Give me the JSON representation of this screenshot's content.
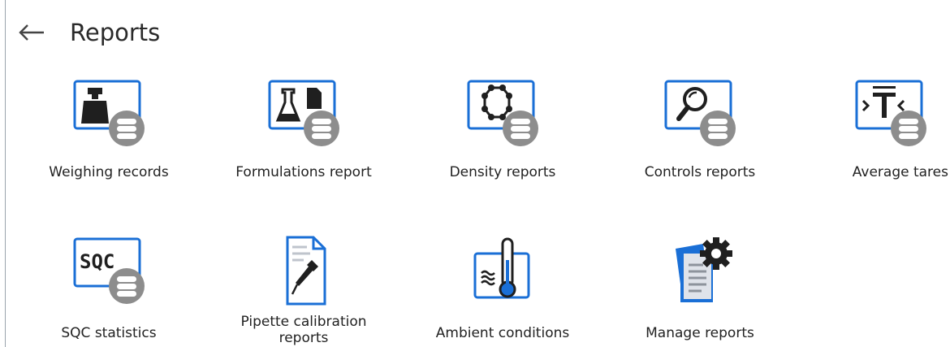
{
  "header": {
    "title": "Reports",
    "back_icon": "arrow-left-icon"
  },
  "tiles": [
    {
      "label": "Weighing records",
      "icon": "weight-database-icon"
    },
    {
      "label": "Formulations report",
      "icon": "flask-document-database-icon"
    },
    {
      "label": "Density reports",
      "icon": "molecule-database-icon"
    },
    {
      "label": "Controls reports",
      "icon": "magnifier-database-icon"
    },
    {
      "label": "Average tares",
      "icon": "tare-database-icon"
    },
    {
      "label": "SQC statistics",
      "icon": "sqc-database-icon"
    },
    {
      "label": "Pipette calibration reports",
      "icon": "pipette-document-icon"
    },
    {
      "label": "Ambient conditions",
      "icon": "thermometer-icon"
    },
    {
      "label": "Manage reports",
      "icon": "documents-gear-icon"
    }
  ],
  "colors": {
    "accent_blue": "#1a6fd6",
    "icon_dark": "#1f1f1f",
    "db_gray": "#8d8d8d",
    "doc_fill": "#dfe3ea"
  }
}
